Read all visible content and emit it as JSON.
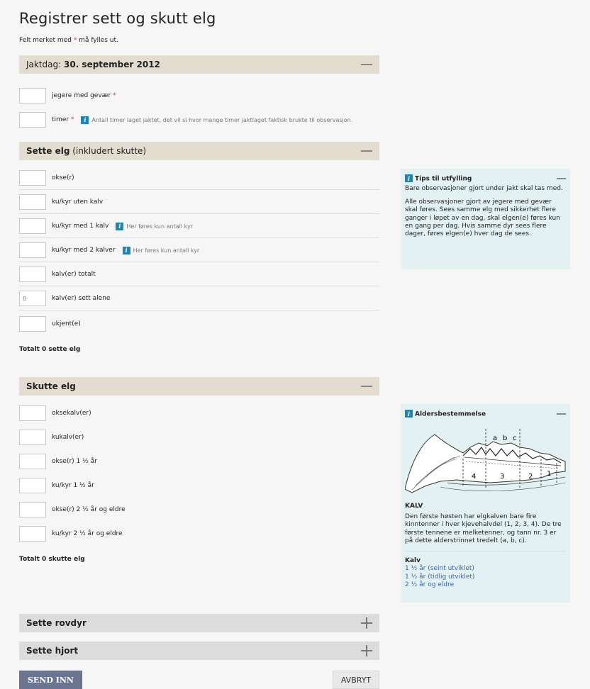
{
  "page": {
    "title": "Registrer sett og skutt elg",
    "required_note_prefix": "Felt merket med ",
    "required_mark": "*",
    "required_note_suffix": " må fylles ut."
  },
  "jaktdag": {
    "label": "Jaktdag: ",
    "date": "30. september 2012",
    "rows": [
      {
        "label": "jegere med gevær",
        "required": true,
        "value": ""
      },
      {
        "label": "timer",
        "required": true,
        "value": "",
        "hint": "Antall timer laget jaktet, det vil si hvor mange timer jaktlaget faktisk brukte til observasjon."
      }
    ]
  },
  "sette": {
    "title": "Sette elg",
    "title_suffix": " (inkludert skutte)",
    "rows": [
      {
        "label": "okse(r)",
        "value": ""
      },
      {
        "label": "ku/kyr uten kalv",
        "value": ""
      },
      {
        "label": "ku/kyr med 1 kalv",
        "value": "",
        "hint": "Her føres kun antall kyr"
      },
      {
        "label": "ku/kyr med 2 kalver",
        "value": "",
        "hint": "Her føres kun antall kyr"
      },
      {
        "label": "kalv(er) totalt",
        "value": ""
      },
      {
        "label": "kalv(er) sett alene",
        "value": "",
        "placeholder": "0"
      },
      {
        "label": "ukjent(e)",
        "value": ""
      }
    ],
    "total": "Totalt 0 sette elg"
  },
  "skutte": {
    "title": "Skutte elg",
    "rows": [
      {
        "label": "oksekalv(er)",
        "value": ""
      },
      {
        "label": "kukalv(er)",
        "value": ""
      },
      {
        "label": "okse(r) 1 ½ år",
        "value": ""
      },
      {
        "label": "ku/kyr 1 ½ år",
        "value": ""
      },
      {
        "label": "okse(r) 2 ½ år og eldre",
        "value": ""
      },
      {
        "label": "ku/kyr 2 ½ år og eldre",
        "value": ""
      }
    ],
    "total": "Totalt 0 skutte elg"
  },
  "rovdyr": {
    "title": "Sette rovdyr"
  },
  "hjort": {
    "title": "Sette hjort"
  },
  "tips": {
    "title": "Tips til utfylling",
    "p1": "Bare observasjoner gjort under jakt skal tas med.",
    "p2": "Alle observasjoner gjort av jegere med gevær skal føres. Sees samme elg med sikkerhet flere ganger i løpet av en dag, skal elgen(e) føres kun en gang per dag. Hvis samme dyr sees flere dager, føres elgen(e) hver dag de sees."
  },
  "alder": {
    "title": "Aldersbestemmelse",
    "diagram_labels": [
      "a",
      "b",
      "c",
      "4",
      "3",
      "2",
      "1"
    ],
    "heading": "KALV",
    "text": "Den første høsten har elgkalven bare fire kinntenner i hver kjevehalvdel (1, 2, 3, 4). De tre første tennene er melketenner, og tann nr. 3 er på dette alderstrinnet tredelt (a, b, c).",
    "current": "Kalv",
    "links": [
      "1 ½ år (seint utviklet)",
      "1 ½ år (tidlig utviklet)",
      "2 ½ år og eldre"
    ]
  },
  "buttons": {
    "send": "SEND INN",
    "cancel": "AVBRYT"
  },
  "icons": {
    "info": "info-icon",
    "collapse": "minus-icon",
    "expand": "plus-icon"
  },
  "colors": {
    "section_tan": "#e4dccf",
    "section_grey": "#dcdcdc",
    "info_blue": "#1f84b7",
    "panel_bg": "#e3f1f2",
    "send_button": "#6b7592"
  }
}
